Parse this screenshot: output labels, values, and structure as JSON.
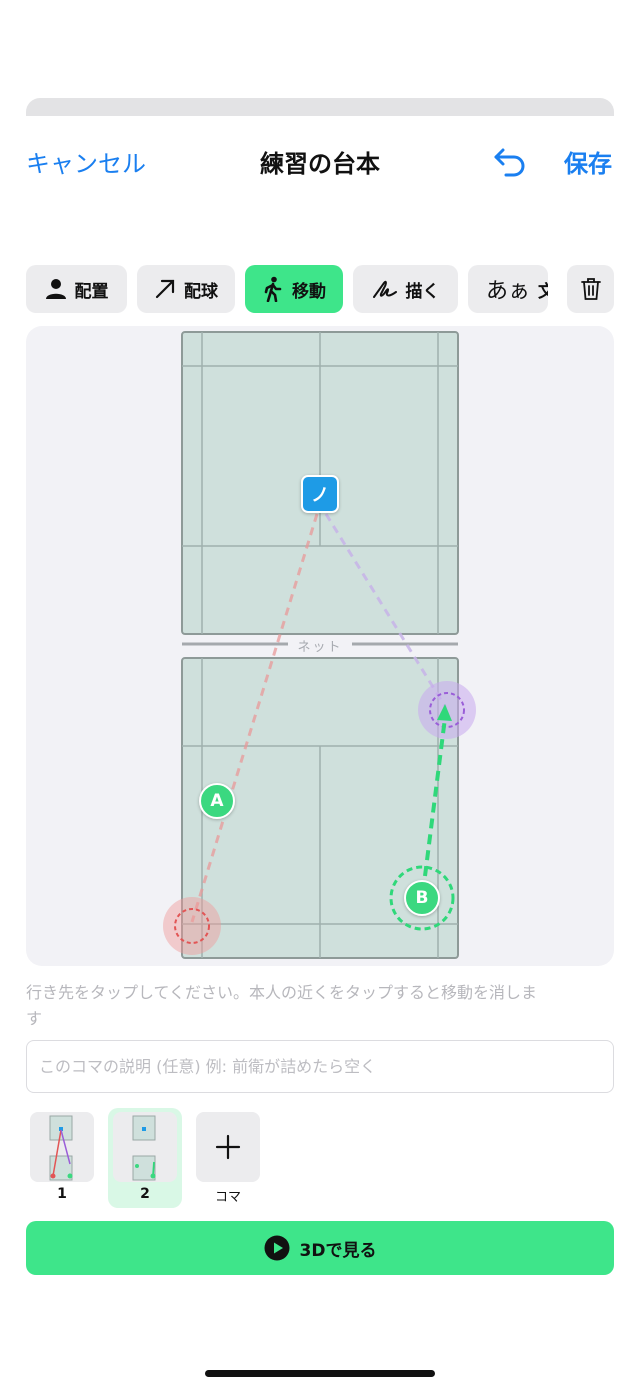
{
  "nav": {
    "cancel_label": "キャンセル",
    "title": "練習の台本",
    "save_label": "保存",
    "undo_icon": "undo-arrow-icon"
  },
  "toolbar": {
    "items": [
      {
        "label": "配置",
        "icon": "person-icon",
        "active": false
      },
      {
        "label": "配球",
        "icon": "arrow-up-right-icon",
        "active": false
      },
      {
        "label": "移動",
        "icon": "walking-person-icon",
        "active": true
      },
      {
        "label": "描く",
        "icon": "scribble-icon",
        "active": false
      },
      {
        "label": "文",
        "glyph": "あぁ",
        "icon": "text-icon",
        "active": false
      }
    ],
    "delete_icon": "trash-icon"
  },
  "court": {
    "net_label": "ネット",
    "players": [
      {
        "label": "ノ",
        "shape": "square",
        "color": "#1e9be6"
      },
      {
        "label": "A",
        "shape": "circle",
        "color": "#3bd880"
      },
      {
        "label": "B",
        "shape": "circle",
        "color": "#3bd880"
      }
    ],
    "colors": {
      "court_fill": "#cfe0dc",
      "court_line": "#8e9a98",
      "shot_red": "#e86a6a",
      "shot_purple": "#a67ad8",
      "move_green": "#2fd87a"
    }
  },
  "hint": "行き先をタップしてください。本人の近くをタップすると移動を消します",
  "description": {
    "placeholder": "このコマの説明 (任意) 例: 前衛が詰めたら空く",
    "value": ""
  },
  "frames": [
    {
      "number": "1",
      "selected": false
    },
    {
      "number": "2",
      "selected": true
    }
  ],
  "add_frame_label": "コマ",
  "play_button_label": "3Dで見る",
  "accent_color": "#3ee58a",
  "link_color": "#1a7ff0"
}
